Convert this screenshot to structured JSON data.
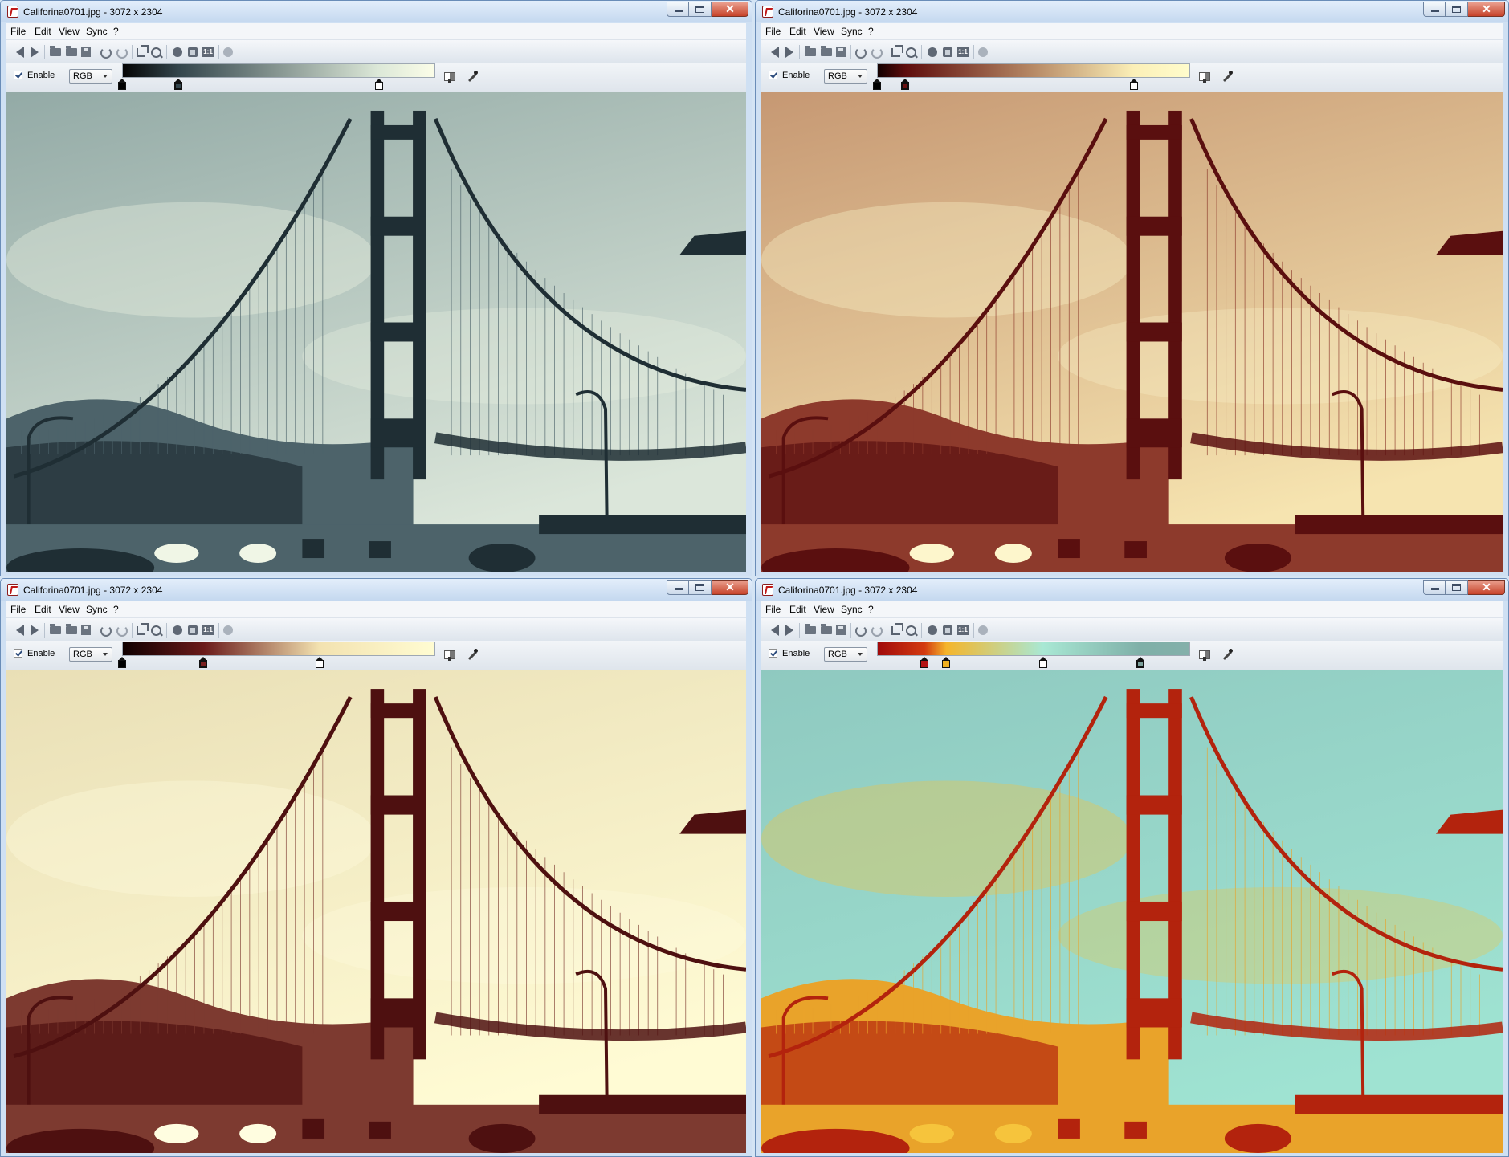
{
  "windows": [
    {
      "title": "Califorina0701.jpg - 3072 x 2304",
      "menu": [
        "File",
        "Edit",
        "View",
        "Sync",
        "?"
      ],
      "enable_label": "Enable",
      "enabled": true,
      "channel": "RGB",
      "gradient": [
        {
          "pos": 0,
          "color": "#050505"
        },
        {
          "pos": 0.18,
          "color": "#33454c"
        },
        {
          "pos": 0.82,
          "color": "#dce8d8"
        },
        {
          "pos": 1,
          "color": "#fbfde8"
        }
      ],
      "stops": [
        {
          "pos": 0,
          "color": "#000000"
        },
        {
          "pos": 0.18,
          "color": "#33454c",
          "selected": true
        },
        {
          "pos": 0.82,
          "color": "#ffffff"
        }
      ],
      "palette": {
        "dark": "#1f2e34",
        "mid": "#4d636a",
        "sky_top": "#93aaa6",
        "sky_bottom": "#dbe6da",
        "highlight": "#f0f6e6"
      }
    },
    {
      "title": "Califorina0701.jpg - 3072 x 2304",
      "menu": [
        "File",
        "Edit",
        "View",
        "Sync",
        "?"
      ],
      "enable_label": "Enable",
      "enabled": true,
      "channel": "RGB",
      "gradient": [
        {
          "pos": 0,
          "color": "#120000"
        },
        {
          "pos": 0.09,
          "color": "#5e0d0d"
        },
        {
          "pos": 0.5,
          "color": "#b78a66"
        },
        {
          "pos": 0.82,
          "color": "#fbefb7"
        },
        {
          "pos": 1,
          "color": "#fffccc"
        }
      ],
      "stops": [
        {
          "pos": 0,
          "color": "#000000"
        },
        {
          "pos": 0.09,
          "color": "#6b1212",
          "selected": true
        },
        {
          "pos": 0.82,
          "color": "#ffffff"
        }
      ],
      "palette": {
        "dark": "#5a0f0f",
        "mid": "#8d3a2c",
        "sky_top": "#c69873",
        "sky_bottom": "#f6e4b0",
        "highlight": "#fdf6cc"
      }
    },
    {
      "title": "Califorina0701.jpg - 3072 x 2304",
      "menu": [
        "File",
        "Edit",
        "View",
        "Sync",
        "?"
      ],
      "enable_label": "Enable",
      "enabled": true,
      "channel": "RGB",
      "gradient": [
        {
          "pos": 0,
          "color": "#100000"
        },
        {
          "pos": 0.26,
          "color": "#6a1a1a"
        },
        {
          "pos": 0.63,
          "color": "#f3e2b0"
        },
        {
          "pos": 1,
          "color": "#fffcd2"
        }
      ],
      "stops": [
        {
          "pos": 0,
          "color": "#000000"
        },
        {
          "pos": 0.26,
          "color": "#7a2020",
          "selected": true
        },
        {
          "pos": 0.63,
          "color": "#ffffff"
        }
      ],
      "palette": {
        "dark": "#4e1010",
        "mid": "#7d3a30",
        "sky_top": "#e9dfb6",
        "sky_bottom": "#fffbd4",
        "highlight": "#fffde0"
      }
    },
    {
      "title": "Califorina0701.jpg - 3072 x 2304",
      "menu": [
        "File",
        "Edit",
        "View",
        "Sync",
        "?"
      ],
      "enable_label": "Enable",
      "enabled": true,
      "channel": "RGB",
      "gradient": [
        {
          "pos": 0,
          "color": "#a10a0a"
        },
        {
          "pos": 0.15,
          "color": "#d33a10"
        },
        {
          "pos": 0.22,
          "color": "#f5b52b"
        },
        {
          "pos": 0.53,
          "color": "#a9e8d4"
        },
        {
          "pos": 0.84,
          "color": "#7fb0a8"
        },
        {
          "pos": 1,
          "color": "#84b0aa"
        }
      ],
      "stops": [
        {
          "pos": 0.15,
          "color": "#b41414"
        },
        {
          "pos": 0.22,
          "color": "#f0b020"
        },
        {
          "pos": 0.53,
          "color": "#ffffff"
        },
        {
          "pos": 0.84,
          "color": "#7b9f9a",
          "selected": true
        }
      ],
      "palette": {
        "dark": "#b3230d",
        "mid": "#e9a32a",
        "sky_top": "#8fc9c0",
        "sky_bottom": "#9fe3d2",
        "highlight": "#f6c43c"
      }
    }
  ]
}
